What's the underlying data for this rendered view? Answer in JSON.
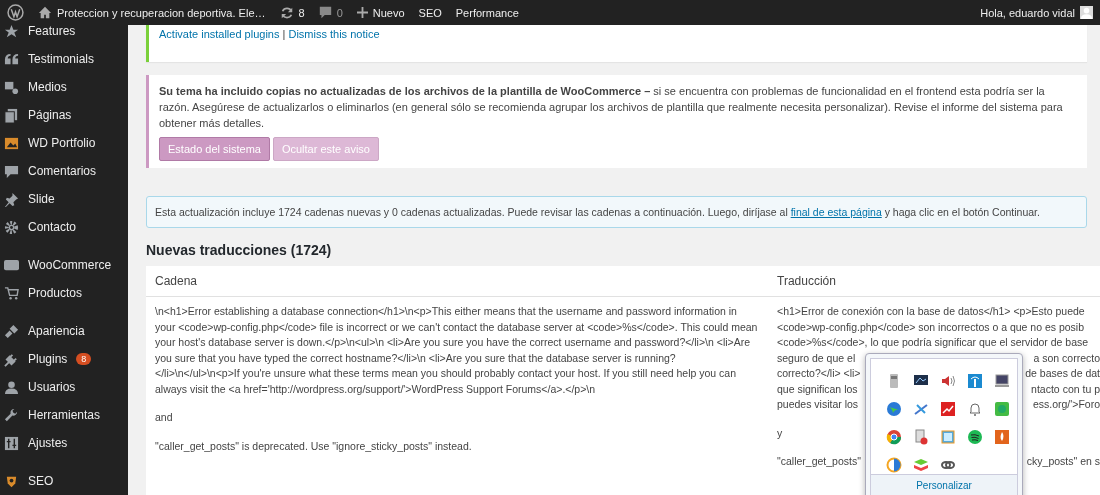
{
  "admin_bar": {
    "site_title": "Proteccion y recuperacion deportiva. Ele…",
    "updates": "8",
    "comments": "0",
    "new": "Nuevo",
    "links": [
      "SEO",
      "Performance"
    ],
    "greeting": "Hola, eduardo vidal"
  },
  "sidebar": {
    "groups": [
      [
        {
          "label": "Features"
        },
        {
          "label": "Testimonials"
        },
        {
          "label": "Medios"
        },
        {
          "label": "Páginas"
        },
        {
          "label": "WD Portfolio"
        },
        {
          "label": "Comentarios"
        },
        {
          "label": "Slide"
        },
        {
          "label": "Contacto"
        }
      ],
      [
        {
          "label": "WooCommerce"
        },
        {
          "label": "Productos"
        }
      ],
      [
        {
          "label": "Apariencia"
        },
        {
          "label": "Plugins",
          "badge": "8"
        },
        {
          "label": "Usuarios"
        },
        {
          "label": "Herramientas"
        },
        {
          "label": "Ajustes"
        }
      ],
      [
        {
          "label": "SEO"
        }
      ]
    ]
  },
  "plugin_notice": {
    "links": [
      "Activate installed plugins",
      "Dismiss this notice"
    ],
    "separator": "|"
  },
  "theme_notice": {
    "text": "**Su tema ha incluido copias no actualizadas de los archivos de la plantilla de WooCommerce –** si se encuentra con problemas de funcionalidad en el frontend esta podría ser la razón. Asegúrese de actualizarlos o eliminarlos (en general sólo se recomienda agrupar los archivos de plantilla que realmente necesita personalizar). Revise el informe del sistema para obtener más detalles.",
    "buttons": [
      {
        "label": "Estado del sistema",
        "kind": "primary"
      },
      {
        "label": "Ocultar este aviso",
        "kind": "secondary"
      }
    ]
  },
  "info_notice": {
    "before": "Esta actualización incluye 1724 cadenas nuevas y 0 cadenas actualizadas. Puede revisar las cadenas a continuación. Luego, diríjase al",
    "link": "final de esta página",
    "after": "y haga clic en el botón Continuar."
  },
  "heading": "Nuevas traducciones (1724)",
  "table": {
    "columns": [
      "Cadena",
      "Traducción"
    ],
    "source": [
      "\\n<h1>Error establishing a database connection</h1>\\n<p>This either means that the username and password information in your <code>wp-config.php</code> file is incorrect or we can't contact the database server at <code>%s</code>. This could mean your host's database server is down.</p>\\n<ul>\\n <li>Are you sure you have the correct username and password?</li>\\n <li>Are you sure that you have typed the correct hostname?</li>\\n <li>Are you sure that the database server is running?</li>\\n</ul>\\n<p>If you're unsure what these terms mean you should probably contact your host. If you still need help you can always visit the <a href='http://wordpress.org/support/'>WordPress Support Forums</a>.</p>\\n",
      "and",
      "\"caller_get_posts\" is deprecated. Use \"ignore_sticky_posts\" instead."
    ],
    "translation": [
      [
        {
          "left": "<h1>Error de conexión con la base de datos</h1> <p>Esto puede"
        },
        {
          "left": "<code>wp-config.php</code> son incorrectos o a que no es posib"
        },
        {
          "left": "<code>%s</code>, lo que podría significar que el servidor de base"
        },
        {
          "left": "seguro de que el",
          "right": "a son correcto"
        },
        {
          "left": "correcto?</li> <li>",
          "right": "de bases de dat"
        },
        {
          "left": "que significan los",
          "right": "ntacto con tu p"
        },
        {
          "left": "puedes visitar los",
          "right": "ess.org/'>Foro"
        }
      ],
      [
        {
          "left": "y"
        }
      ],
      [
        {
          "left": "\"caller_get_posts\"",
          "right": "cky_posts\" en s"
        }
      ]
    ]
  },
  "tray_popup": {
    "link": "Personalizar"
  }
}
